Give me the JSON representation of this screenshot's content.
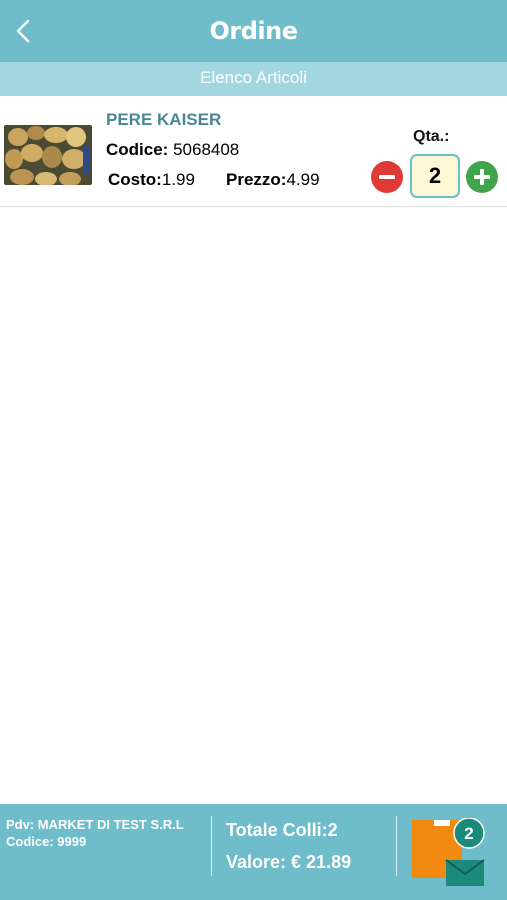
{
  "header": {
    "title": "Ordine",
    "back_icon": "back-chevron-icon"
  },
  "subheader": {
    "label": "Elenco Articoli"
  },
  "items": [
    {
      "name": "PERE KAISER",
      "code_label": "Codice:",
      "code": "5068408",
      "cost_label": "Costo:",
      "cost": "1.99",
      "price_label": "Prezzo:",
      "price": "4.99",
      "qty_label": "Qta.:",
      "qty": "2"
    }
  ],
  "footer": {
    "pdv": "Pdv: MARKET DI TEST S.R.L",
    "code": "Codice: 9999",
    "total_colli": "Totale Colli:2",
    "valore": "Valore: € 21.89",
    "badge": "2"
  },
  "colors": {
    "primary": "#6fbccb",
    "subheader": "#a2d6e0",
    "minus": "#e03a37",
    "plus": "#3fa44a",
    "qty_bg": "#fff8d6",
    "name": "#4a8794",
    "cart_orange": "#f28a12",
    "cart_green": "#1c8a7a"
  }
}
